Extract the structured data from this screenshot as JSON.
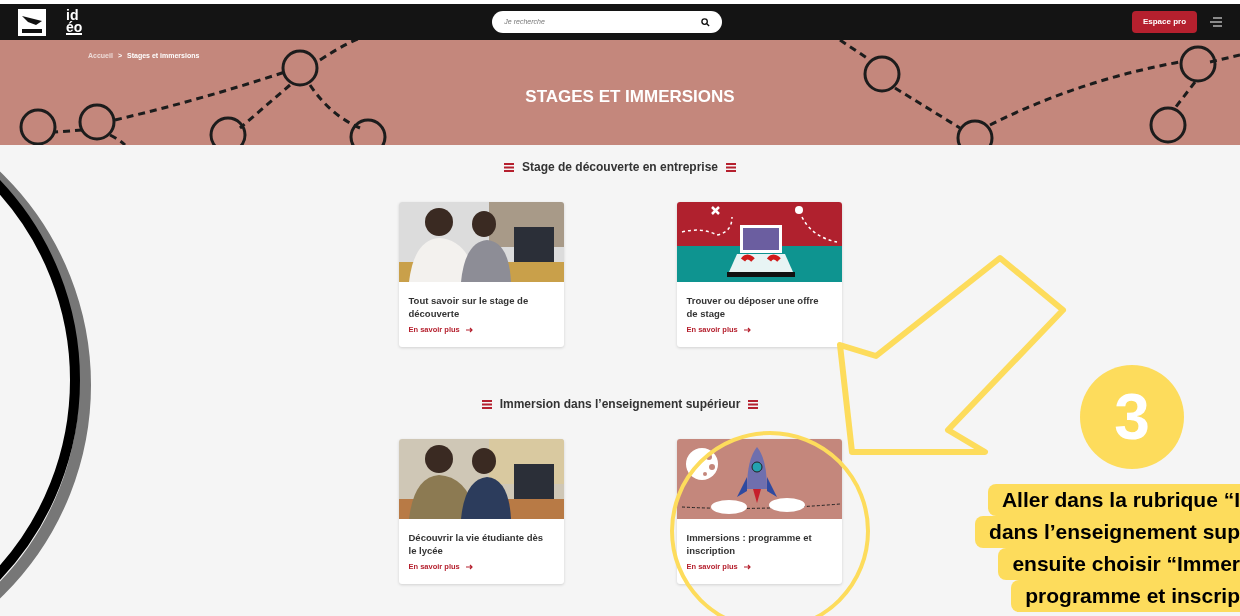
{
  "header": {
    "brand_lines": [
      "id",
      "éo"
    ],
    "search": {
      "placeholder": "Je recherche"
    },
    "pro_button": "Espace pro"
  },
  "banner": {
    "breadcrumb": [
      "Accueil",
      "Stages et immersions"
    ],
    "separator": ">",
    "title": "STAGES ET IMMERSIONS"
  },
  "sections": [
    {
      "title": "Stage de découverte en entreprise",
      "cards": [
        {
          "title": "Tout savoir sur le stage de découverte",
          "link": "En savoir plus"
        },
        {
          "kind": "laptop",
          "title": "Trouver ou déposer une offre de stage",
          "link": "En savoir plus"
        }
      ]
    },
    {
      "title": "Immersion dans l’enseignement supérieur",
      "cards": [
        {
          "title": "Découvrir la vie étudiante dès le lycée",
          "link": "En savoir plus"
        },
        {
          "kind": "rocket",
          "title": "Immersions : programme et inscription",
          "link": "En savoir plus"
        }
      ]
    }
  ],
  "annotation": {
    "step": "3",
    "lines": [
      "Aller dans la rubrique “I",
      "dans l’enseignement sup",
      "ensuite choisir “Immer",
      "programme et inscrip"
    ]
  }
}
